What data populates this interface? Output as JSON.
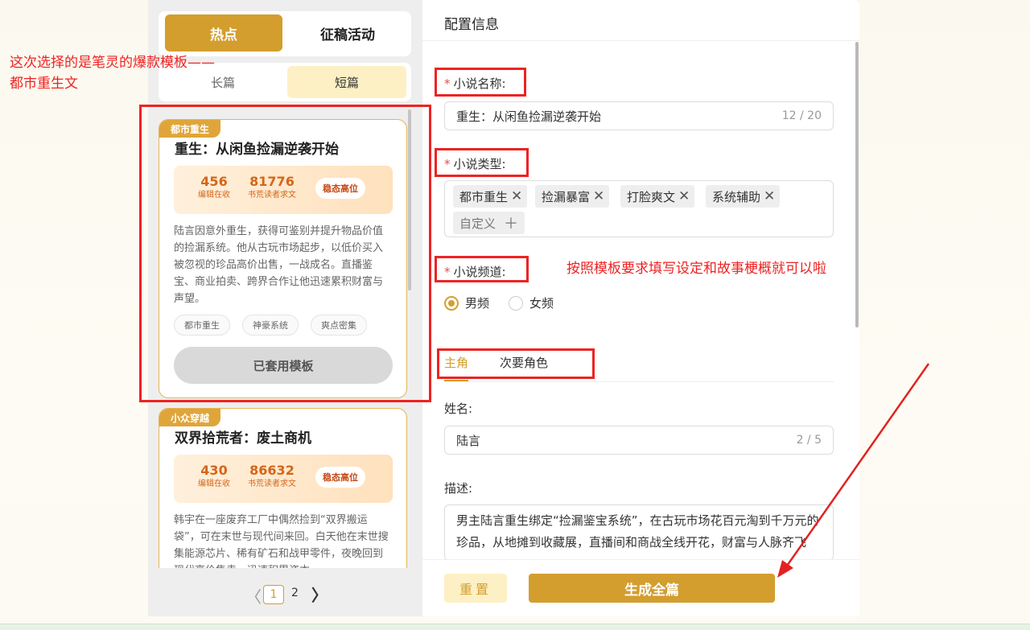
{
  "left": {
    "tabs": {
      "hot": "热点",
      "activity": "征稿活动"
    },
    "length": {
      "long": "长篇",
      "short": "短篇"
    },
    "cards": [
      {
        "tag": "都市重生",
        "title": "重生：从闲鱼捡漏逆袭开始",
        "stat1_num": "456",
        "stat1_lbl": "编辑在收",
        "stat2_num": "81776",
        "stat2_lbl": "书荒读者求文",
        "badge": "稳态高位",
        "desc": "陆言因意外重生，获得可鉴别并提升物品价值的捡漏系统。他从古玩市场起步，以低价买入被忽视的珍品高价出售，一战成名。直播鉴宝、商业拍卖、跨界合作让他迅速累积财富与声望。",
        "chips": [
          "都市重生",
          "神豪系统",
          "爽点密集"
        ],
        "button": "已套用模板"
      },
      {
        "tag": "小众穿越",
        "title": "双界拾荒者：废土商机",
        "stat1_num": "430",
        "stat1_lbl": "编辑在收",
        "stat2_num": "86632",
        "stat2_lbl": "书荒读者求文",
        "badge": "稳态高位",
        "desc": "韩宇在一座废弃工厂中偶然捡到“双界搬运袋”，可在末世与现代间来回。白天他在末世搜集能源芯片、稀有矿石和战甲零件，夜晚回到现代高价售卖，迅速积累资本。"
      }
    ],
    "pager": {
      "prev": "〈",
      "p1": "1",
      "p2": "2",
      "next": "〉"
    }
  },
  "right": {
    "header": "配置信息",
    "name_label": "小说名称:",
    "name_value": "重生：从闲鱼捡漏逆袭开始",
    "name_count": "12 / 20",
    "type_label": "小说类型:",
    "types": [
      "都市重生",
      "捡漏暴富",
      "打脸爽文",
      "系统辅助"
    ],
    "type_custom": "自定义",
    "channel_label": "小说频道:",
    "channel_male": "男频",
    "channel_female": "女频",
    "role_main": "主角",
    "role_secondary": "次要角色",
    "char_name_label": "姓名:",
    "char_name_value": "陆言",
    "char_name_count": "2 / 5",
    "desc_label": "描述:",
    "desc_value": "男主陆言重生绑定“捡漏鉴宝系统”，在古玩市场花百元淘到千万元的珍品，从地摊到收藏展，直播间和商战全线开花，财富与人脉齐飞",
    "reset": "重置",
    "generate": "生成全篇"
  },
  "annotations": {
    "left_note_1": "这次选择的是笔灵的爆款模板——",
    "left_note_2": "都市重生文",
    "right_note": "按照模板要求填写设定和故事梗概就可以啦"
  },
  "colors": {
    "accent": "#d39e2e",
    "annotation": "#e22222"
  }
}
